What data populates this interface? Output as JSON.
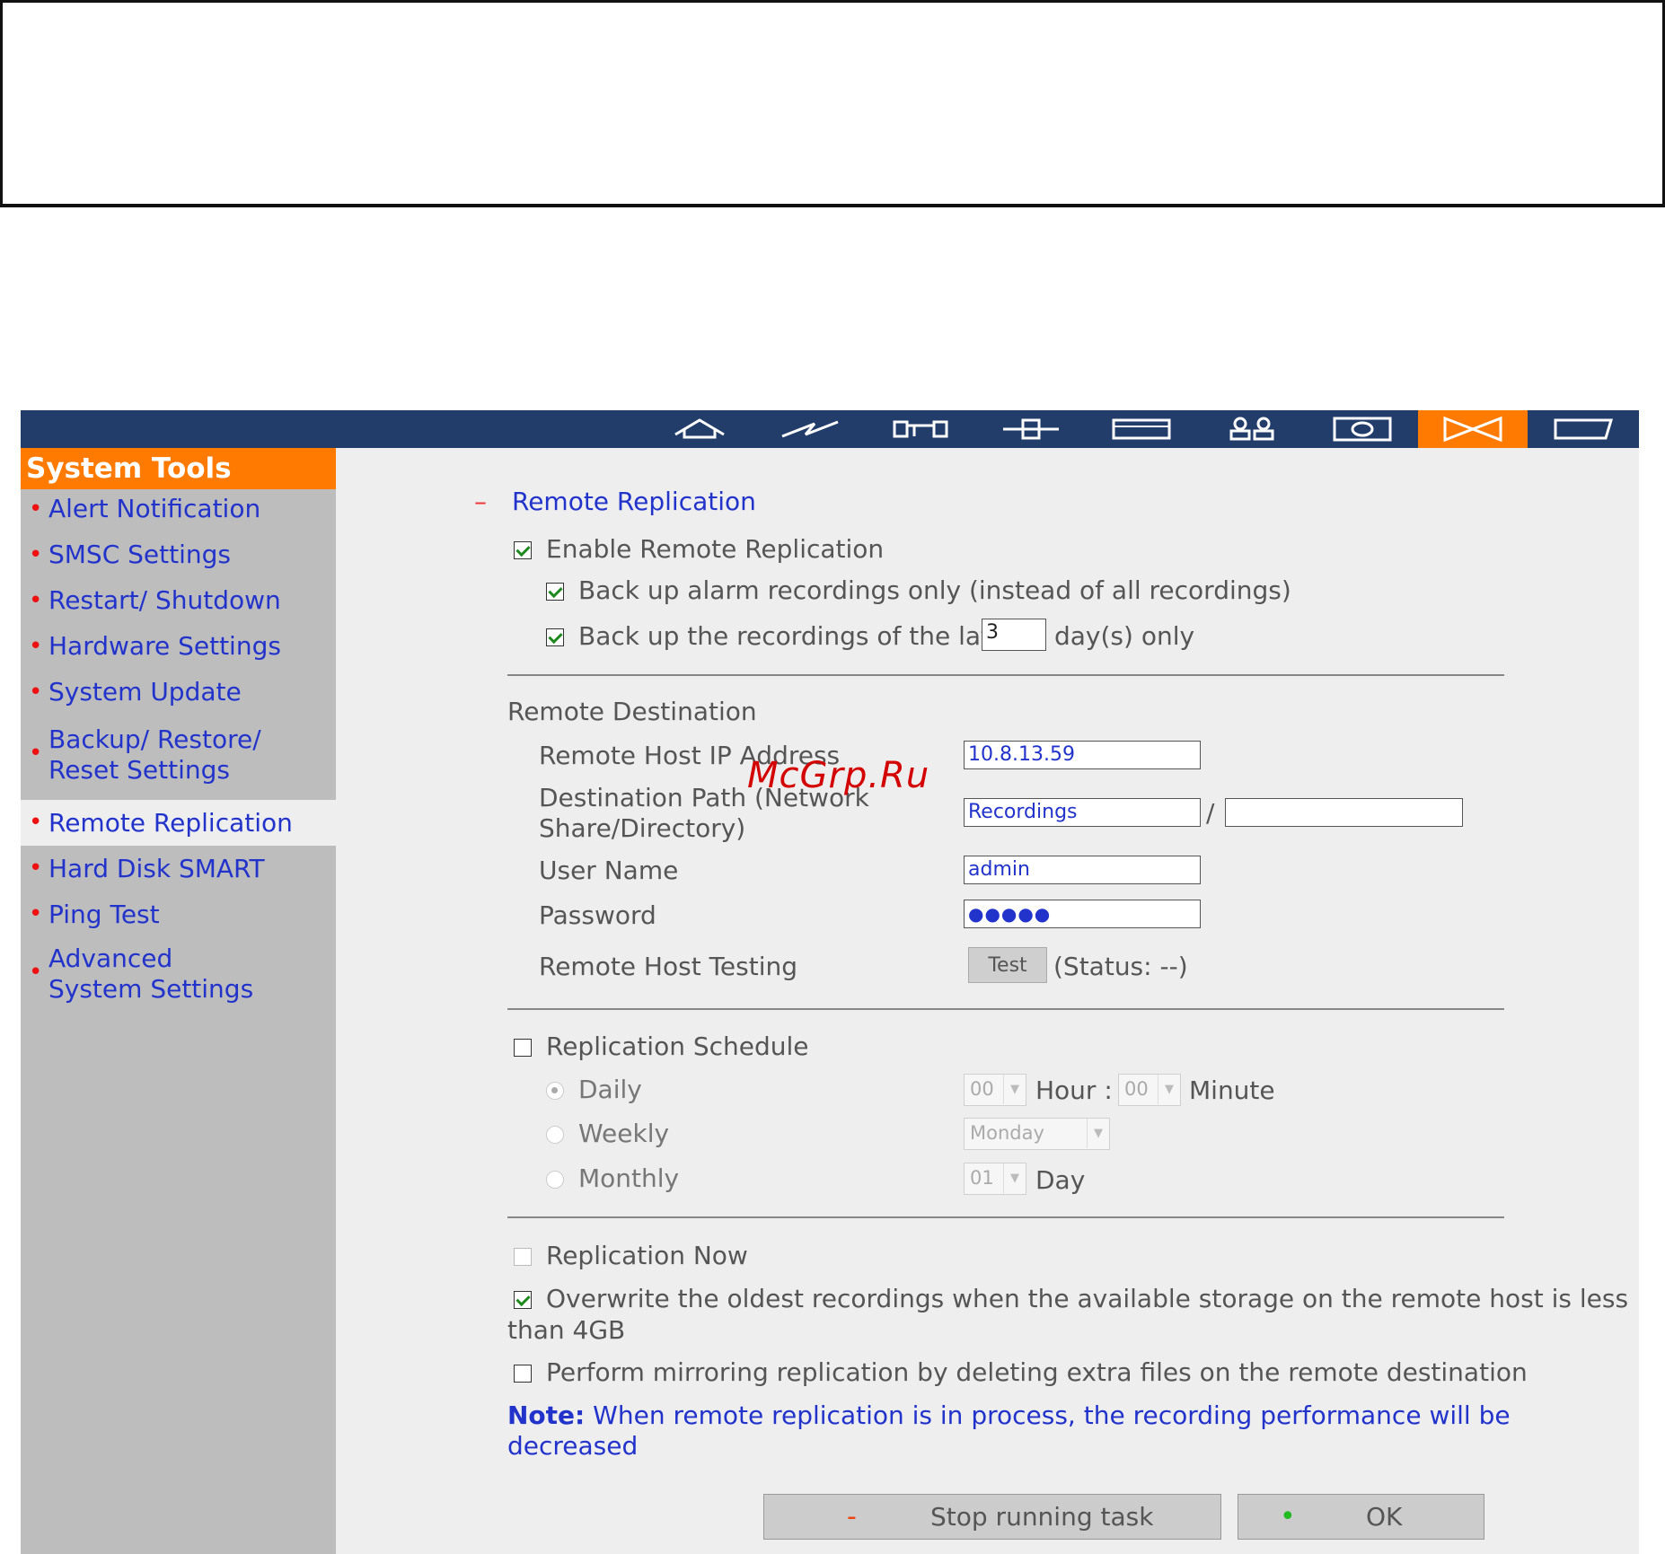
{
  "sidebar": {
    "title": "System Tools",
    "items": [
      {
        "label": "Alert Notification"
      },
      {
        "label": "SMSC Settings"
      },
      {
        "label": "Restart/ Shutdown"
      },
      {
        "label": "Hardware Settings"
      },
      {
        "label": "System Update"
      },
      {
        "label": "Backup/ Restore/ Reset Settings"
      },
      {
        "label": "Remote Replication"
      },
      {
        "label": "Hard Disk SMART"
      },
      {
        "label": "Ping Test"
      },
      {
        "label": "Advanced System Settings"
      }
    ],
    "active": "Remote Replication"
  },
  "nav": {
    "icons": [
      "home-icon",
      "quick-config-icon",
      "system-settings-icon",
      "network-icon",
      "device-icon",
      "users-icon",
      "camera-icon",
      "system-tools-icon",
      "logs-icon"
    ],
    "active": "system-tools-icon"
  },
  "section": {
    "collapse_mark": "–",
    "title": "Remote Replication",
    "enable_label": "Enable Remote Replication",
    "alarm_only_label": "Back up alarm recordings only (instead of all recordings)",
    "latest_prefix": "Back up the recordings of the latest",
    "latest_days": "3",
    "latest_suffix": "day(s) only"
  },
  "destination": {
    "heading": "Remote Destination",
    "ip_label": "Remote Host IP Address",
    "ip_value": "10.8.13.59",
    "path_label_line1": "Destination Path (Network",
    "path_label_line2": "Share/Directory)",
    "path_value": "Recordings",
    "path_separator": "/",
    "path_sub_value": "",
    "user_label": "User Name",
    "user_value": "admin",
    "password_label": "Password",
    "password_mask": "●●●●●",
    "testing_label": "Remote Host Testing",
    "test_button": "Test",
    "status_text": "(Status: --)"
  },
  "schedule": {
    "label": "Replication Schedule",
    "daily_label": "Daily",
    "weekly_label": "Weekly",
    "monthly_label": "Monthly",
    "hour_value": "00",
    "hour_label": "Hour :",
    "minute_value": "00",
    "minute_label": "Minute",
    "weekday_value": "Monday",
    "day_value": "01",
    "day_label": "Day"
  },
  "options": {
    "now_label": "Replication Now",
    "overwrite_line1": "Overwrite the oldest recordings when the available storage on the remote host is less",
    "overwrite_line2": "than 4GB",
    "mirror_label": "Perform mirroring replication by deleting extra files on the remote destination",
    "note_bold": "Note:",
    "note_line1": "When remote replication is in process, the recording performance will be",
    "note_line2": "decreased"
  },
  "buttons": {
    "stop_mark": "-",
    "stop_label": "Stop running task",
    "ok_mark": "•",
    "ok_label": "OK"
  },
  "watermark": "McGrp.Ru",
  "colors": {
    "navbar": "#233d6b",
    "accent": "#ff7a00",
    "link": "#2233cc",
    "bullet": "#ee1111"
  }
}
